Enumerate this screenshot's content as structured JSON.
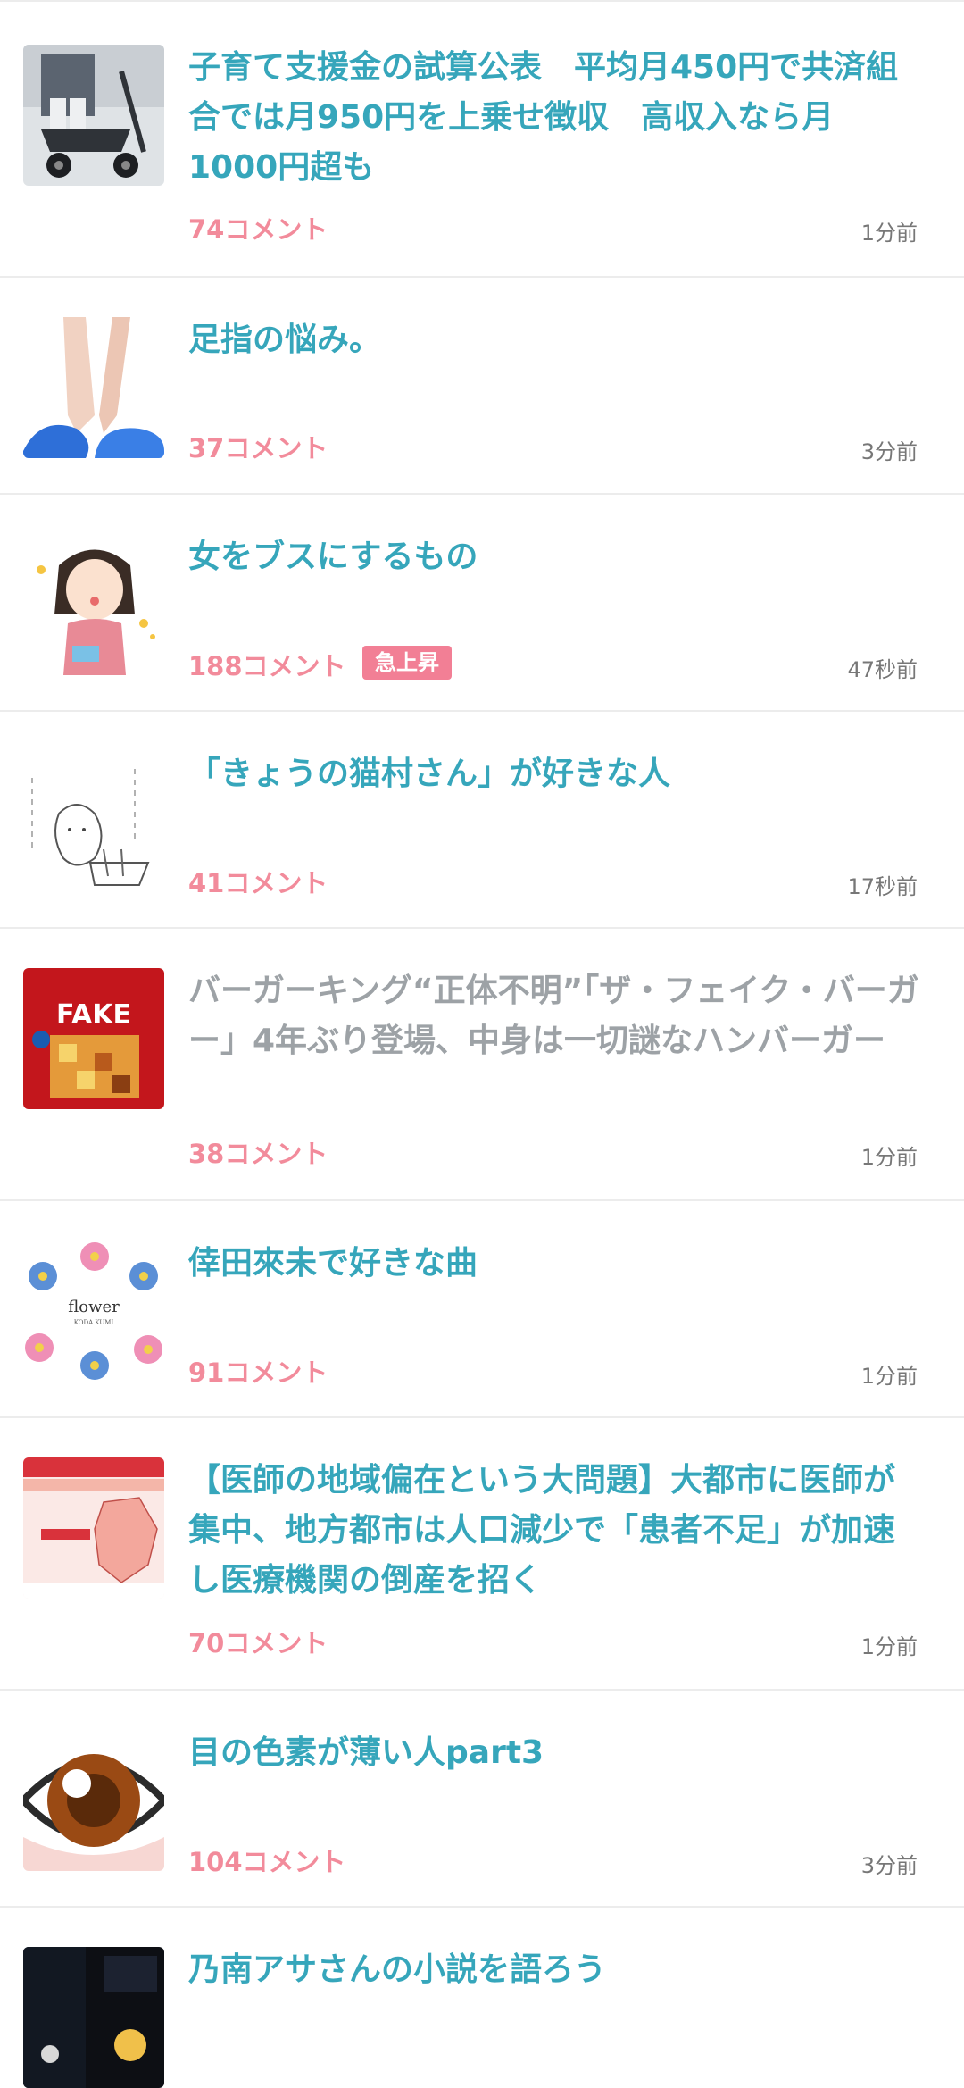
{
  "items": [
    {
      "title": "子育て支援金の試算公表　平均月450円で共済組合では月950円を上乗せ徴収　高収入なら月1000円超も",
      "comments": "74コメント",
      "time": "1分前",
      "thumb": "stroller-photo"
    },
    {
      "title": "足指の悩み。",
      "comments": "37コメント",
      "time": "3分前",
      "thumb": "feet-photo"
    },
    {
      "title": "女をブスにするもの",
      "comments": "188コメント",
      "badge": "急上昇",
      "time": "47秒前",
      "thumb": "woman-illustration"
    },
    {
      "title": "「きょうの猫村さん」が好きな人",
      "comments": "41コメント",
      "time": "17秒前",
      "thumb": "cat-sketch"
    },
    {
      "title": "バーガーキング“正体不明”「ザ・フェイク・バーガー」4年ぶり登場、中身は一切謎なハンバーガー",
      "comments": "38コメント",
      "time": "1分前",
      "thumb": "fake-burger-ad",
      "thumb_text": "FAKE"
    },
    {
      "title": "倖田來未で好きな曲",
      "comments": "91コメント",
      "time": "1分前",
      "thumb": "flower-cover",
      "thumb_text": "flower",
      "thumb_subtext": "KODA KUMI"
    },
    {
      "title": "【医師の地域偏在という大問題】大都市に医師が集中、地方都市は人口減少で「患者不足」が加速し医療機関の倒産を招く",
      "comments": "70コメント",
      "time": "1分前",
      "thumb": "population-map"
    },
    {
      "title": "目の色素が薄い人part3",
      "comments": "104コメント",
      "time": "3分前",
      "thumb": "eye-illustration"
    },
    {
      "title": "乃南アサさんの小説を語ろう",
      "comments": "",
      "time": "",
      "thumb": "book-cover"
    }
  ],
  "colors": {
    "title": "#36a6bb",
    "visited_title": "#9da2a6",
    "comments": "#f28b9b",
    "badge": "#f27f95"
  }
}
